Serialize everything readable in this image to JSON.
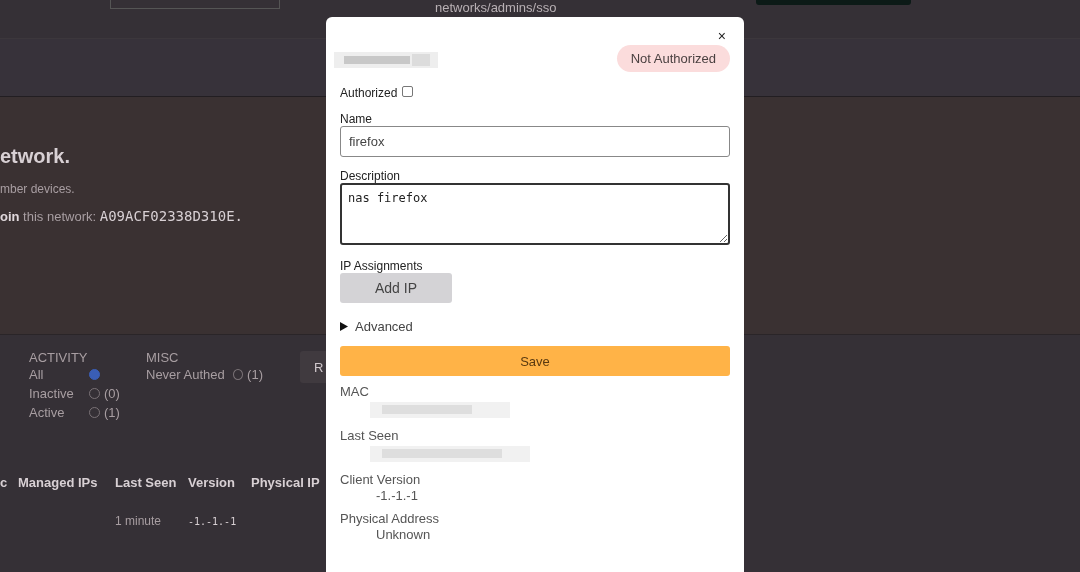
{
  "background_page": {
    "top_path": "networks/admins/sso",
    "heading": "etwork.",
    "subtitle": "mber devices.",
    "join_text": "**oin** this network: ",
    "network_id": "A09ACF02338D310E.",
    "filter_groups": [
      {
        "title": "ACTIVITY",
        "kind": "radio",
        "options": [
          {
            "label": "All",
            "selected": true
          },
          {
            "label": "Inactive",
            "count": "(0)",
            "selected": false
          },
          {
            "label": "Active",
            "count": "(1)",
            "selected": false
          }
        ]
      },
      {
        "title": "MISC",
        "kind": "checkbox",
        "options": [
          {
            "label": "Never Authed",
            "count": "(1)",
            "checked": false
          }
        ]
      }
    ],
    "partial_button": "R",
    "table": {
      "columns": [
        "c",
        "Managed IPs",
        "Last Seen",
        "Version",
        "Physical IP"
      ],
      "rows": [
        {
          "last_seen": "1 minute",
          "version": "-1.-1.-1"
        }
      ]
    }
  },
  "dialog": {
    "close": "×",
    "status_badge": "Not Authorized",
    "authorized": {
      "label": "Authorized",
      "checked": false
    },
    "name": {
      "label": "Name",
      "value": "firefox"
    },
    "description": {
      "label": "Description",
      "value": "nas firefox"
    },
    "ip_assignments": {
      "label": "IP Assignments",
      "button": "Add IP"
    },
    "advanced": {
      "label": "Advanced",
      "expanded": false
    },
    "save": "Save",
    "details": [
      {
        "label": "MAC",
        "kind": "redacted"
      },
      {
        "label": "Last Seen",
        "kind": "redacted"
      },
      {
        "label": "Client Version",
        "kind": "text",
        "value": "-1.-1.-1"
      },
      {
        "label": "Physical Address",
        "kind": "text",
        "value": "Unknown"
      }
    ]
  }
}
